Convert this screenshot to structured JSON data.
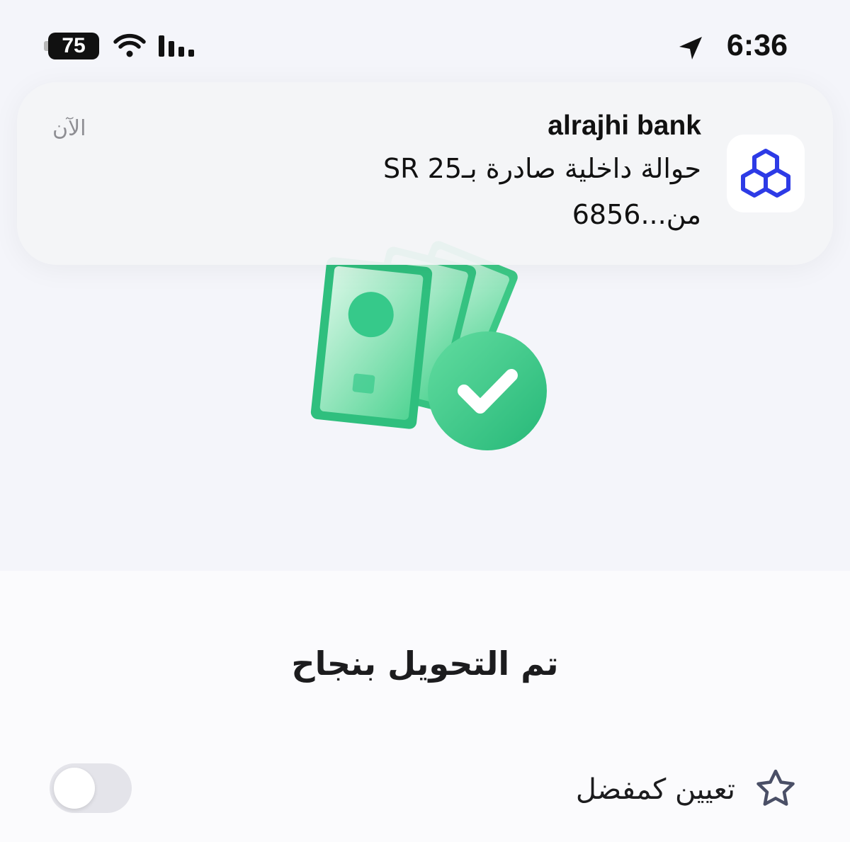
{
  "status_bar": {
    "time": "6:36",
    "battery_level": "75",
    "icons": [
      "location-arrow-icon",
      "wifi-icon",
      "cellular-signal-icon",
      "battery-icon"
    ]
  },
  "notification": {
    "app_name": "alrajhi bank",
    "message_line1": "حوالة داخلية صادرة بـ25 SR",
    "message_line2": "من...6856",
    "timestamp": "الآن",
    "app_icon": "alrajhi-logo-icon",
    "logo_color": "#2d3be6"
  },
  "main": {
    "illustration": "money-success-icon",
    "success_title": "تم التحويل بنجاح",
    "favorite": {
      "label": "تعيين كمفضل",
      "icon": "star-outline-icon",
      "toggle_on": false
    }
  },
  "colors": {
    "accent_green": "#36c98a",
    "background": "#f4f5fa",
    "toggle_off": "#e4e4ea"
  }
}
